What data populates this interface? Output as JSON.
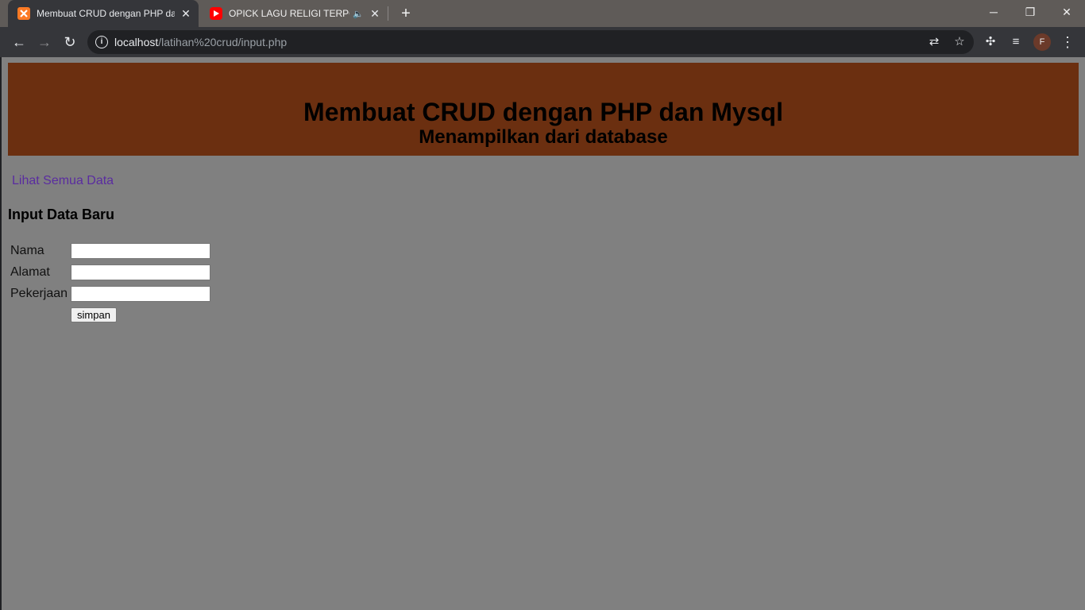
{
  "browser": {
    "tabs": [
      {
        "title": "Membuat CRUD dengan PHP dan Mysql",
        "favicon": "xampp-icon",
        "active": true
      },
      {
        "title": "OPICK LAGU RELIGI TERPOPULER",
        "favicon": "youtube-icon",
        "active": false,
        "audio": true
      }
    ],
    "url_host": "localhost",
    "url_path": "/latihan%20crud/input.php",
    "profile_initial": "F"
  },
  "page": {
    "title": "Membuat CRUD dengan PHP dan Mysql",
    "subtitle": "Menampilkan dari database",
    "nav_link": "Lihat Semua Data",
    "form_heading": "Input Data Baru",
    "fields": [
      {
        "label": "Nama",
        "value": ""
      },
      {
        "label": "Alamat",
        "value": ""
      },
      {
        "label": "Pekerjaan",
        "value": ""
      }
    ],
    "submit_label": "simpan"
  },
  "colors": {
    "page_background": "#808080",
    "header_background": "#6b2f10",
    "link": "#5a2ca0"
  }
}
